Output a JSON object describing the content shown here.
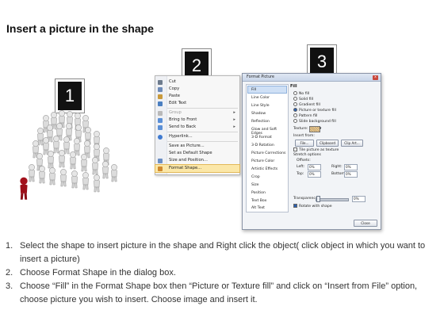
{
  "title": "Insert a picture in the shape",
  "step_boxes": [
    "1",
    "2",
    "3"
  ],
  "context_menu": {
    "items": [
      {
        "label": "Cut",
        "icon": "scissors-icon",
        "color": "#6d7b8d",
        "disabled": false
      },
      {
        "label": "Copy",
        "icon": "copy-icon",
        "color": "#6d8bb8",
        "disabled": false
      },
      {
        "label": "Paste",
        "icon": "paste-icon",
        "color": "#c99a3c",
        "disabled": false
      },
      {
        "label": "Edit Text",
        "icon": "edit-text-icon",
        "color": "#4a7fc1",
        "disabled": false
      },
      {
        "label": "Group",
        "icon": "group-icon",
        "color": "#b9b9b9",
        "disabled": true,
        "submenu": true
      },
      {
        "label": "Bring to Front",
        "icon": "bring-front-icon",
        "color": "#5a8fd6",
        "disabled": false,
        "submenu": true
      },
      {
        "label": "Send to Back",
        "icon": "send-back-icon",
        "color": "#5a8fd6",
        "disabled": false,
        "submenu": true
      },
      {
        "label": "Hyperlink...",
        "icon": "hyperlink-icon",
        "color": "#3f7ad0",
        "disabled": false
      },
      {
        "label": "Save as Picture...",
        "icon": "",
        "color": "",
        "disabled": false
      },
      {
        "label": "Set as Default Shape",
        "icon": "",
        "color": "",
        "disabled": false
      },
      {
        "label": "Size and Position...",
        "icon": "size-position-icon",
        "color": "#6b8fc4",
        "disabled": false
      },
      {
        "label": "Format Shape...",
        "icon": "format-shape-icon",
        "color": "#d08a2f",
        "disabled": false,
        "highlighted": true
      }
    ]
  },
  "dialog": {
    "title": "Format Picture",
    "close_label": "x",
    "categories": [
      "Fill",
      "Line Color",
      "Line Style",
      "Shadow",
      "Reflection",
      "Glow and Soft Edges",
      "3-D Format",
      "3-D Rotation",
      "Picture Corrections",
      "Picture Color",
      "Artistic Effects",
      "Crop",
      "Size",
      "Position",
      "Text Box",
      "Alt Text"
    ],
    "selected_category": "Fill",
    "fill_heading": "Fill",
    "fill_options": [
      {
        "label": "No fill",
        "on": false
      },
      {
        "label": "Solid fill",
        "on": false
      },
      {
        "label": "Gradient fill",
        "on": false
      },
      {
        "label": "Picture or texture fill",
        "on": true
      },
      {
        "label": "Pattern fill",
        "on": false
      },
      {
        "label": "Slide background fill",
        "on": false
      }
    ],
    "texture_label": "Texture:",
    "insert_from_label": "Insert from:",
    "insert_buttons": [
      "File...",
      "Clipboard",
      "Clip Art..."
    ],
    "tile_label": "Tile picture as texture",
    "stretch_heading": "Stretch options",
    "offsets_label": "Offsets:",
    "offsets": [
      {
        "label": "Left:",
        "value": "0%"
      },
      {
        "label": "Right:",
        "value": "0%"
      },
      {
        "label": "Top:",
        "value": "0%"
      },
      {
        "label": "Bottom:",
        "value": "0%"
      }
    ],
    "transparency_label": "Transparency:",
    "transparency_value": "0%",
    "rotate_label": "Rotate with shape",
    "close_button": "Close"
  },
  "steps": [
    {
      "n": "1.",
      "text": "Select the shape to insert picture in the shape and Right click the object( click object in which you want to insert a picture)"
    },
    {
      "n": "2.",
      "text": "Choose Format Shape in the dialog box."
    },
    {
      "n": "3.",
      "text": "Choose “Fill” in the Format Shape box then “Picture or Texture fill”  and click on “Insert from File” option, choose picture you wish to insert. Choose image and insert it."
    }
  ],
  "colors": {
    "highlight": "#fbe7a8",
    "figure_gray": "#e2e2e2",
    "figure_red": "#a3111c"
  }
}
